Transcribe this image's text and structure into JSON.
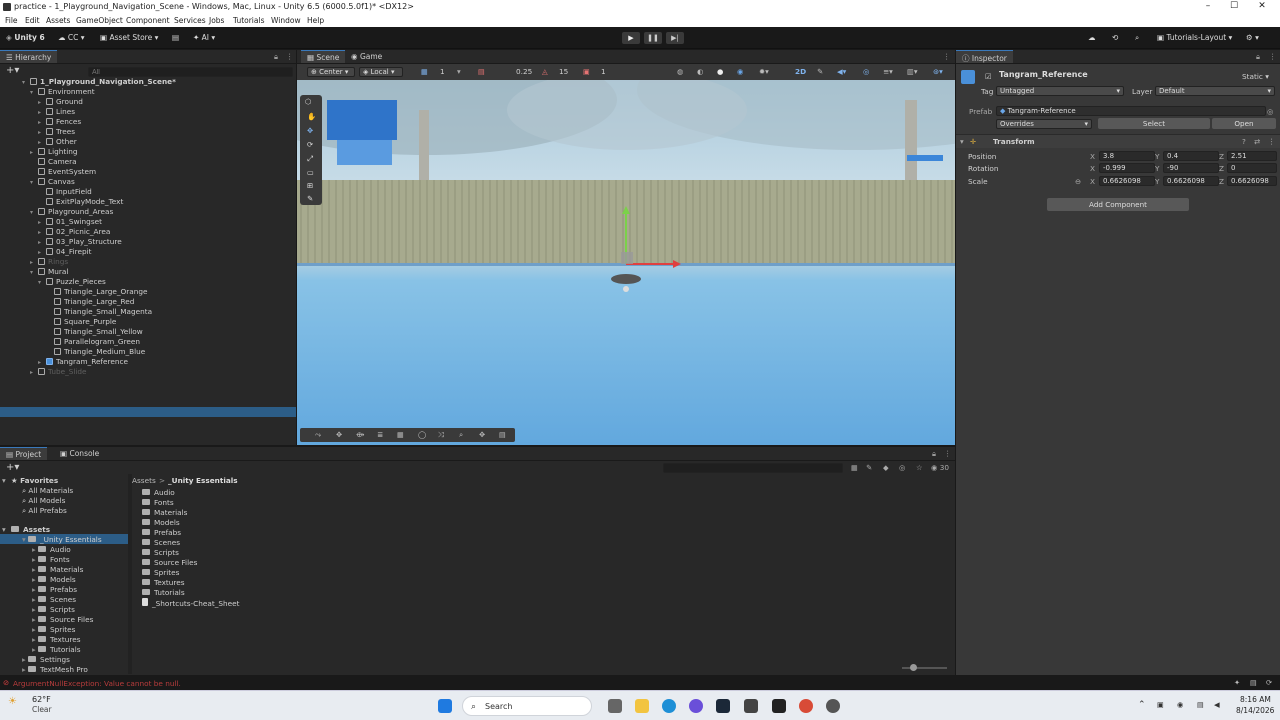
{
  "window": {
    "title": "practice - 1_Playground_Navigation_Scene - Windows, Mac, Linux - Unity 6.5 (6000.5.0f1)* <DX12>"
  },
  "menu": [
    "File",
    "Edit",
    "Assets",
    "GameObject",
    "Component",
    "Services",
    "Jobs",
    "Tutorials",
    "Window",
    "Help"
  ],
  "toolbar": {
    "brand": "Unity 6",
    "account": "CC",
    "asset_store": "Asset Store",
    "ai": "AI",
    "layout": "Tutorials-Layout"
  },
  "hierarchy": {
    "tab": "Hierarchy",
    "search_placeholder": "All",
    "items": [
      {
        "label": "1_Playground_Navigation_Scene*",
        "indent": 0
      },
      {
        "label": "Environment",
        "indent": 1
      },
      {
        "label": "Ground",
        "indent": 2
      },
      {
        "label": "Lines",
        "indent": 2
      },
      {
        "label": "Fences",
        "indent": 2
      },
      {
        "label": "Trees",
        "indent": 2
      },
      {
        "label": "Other",
        "indent": 2
      },
      {
        "label": "Lighting",
        "indent": 1
      },
      {
        "label": "Camera",
        "indent": 1
      },
      {
        "label": "EventSystem",
        "indent": 1
      },
      {
        "label": "Canvas",
        "indent": 1
      },
      {
        "label": "InputField",
        "indent": 2
      },
      {
        "label": "ExitPlayMode_Text",
        "indent": 2
      },
      {
        "label": "Playground_Areas",
        "indent": 1
      },
      {
        "label": "01_Swingset",
        "indent": 2
      },
      {
        "label": "02_Picnic_Area",
        "indent": 2
      },
      {
        "label": "03_Play_Structure",
        "indent": 2
      },
      {
        "label": "04_Firepit",
        "indent": 2
      },
      {
        "label": "Rings",
        "indent": 1,
        "dim": true
      },
      {
        "label": "Mural",
        "indent": 1
      },
      {
        "label": "Puzzle_Pieces",
        "indent": 2
      },
      {
        "label": "Triangle_Large_Orange",
        "indent": 3
      },
      {
        "label": "Triangle_Large_Red",
        "indent": 3
      },
      {
        "label": "Triangle_Small_Magenta",
        "indent": 3
      },
      {
        "label": "Square_Purple",
        "indent": 3
      },
      {
        "label": "Triangle_Small_Yellow",
        "indent": 3
      },
      {
        "label": "Parallelogram_Green",
        "indent": 3
      },
      {
        "label": "Triangle_Medium_Blue",
        "indent": 3
      },
      {
        "label": "Tangram_Reference",
        "indent": 2
      },
      {
        "label": "Tube_Slide",
        "indent": 1,
        "dim": true
      }
    ]
  },
  "scene": {
    "tabs": [
      "Scene",
      "Game"
    ],
    "pivot": "Center",
    "space": "Local",
    "grid_value": "1",
    "snap_value": "0.25",
    "rotate_snap": "15",
    "scale_snap": "1",
    "mode_2d": "2D"
  },
  "inspector": {
    "tab": "Inspector",
    "object_name": "Tangram_Reference",
    "static_label": "Static",
    "tag_label": "Tag",
    "tag_value": "Untagged",
    "layer_label": "Layer",
    "layer_value": "Default",
    "prefab_label": "Prefab",
    "prefab_value": "Tangram-Reference",
    "overrides": "Overrides",
    "select": "Select",
    "open": "Open",
    "transform_title": "Transform",
    "position_label": "Position",
    "rotation_label": "Rotation",
    "scale_label": "Scale",
    "position": {
      "x": "3.8",
      "y": "0.4",
      "z": "2.51"
    },
    "rotation": {
      "x": "-0.999",
      "y": "-90",
      "z": "0"
    },
    "scale": {
      "x": "0.6626098",
      "y": "0.6626098",
      "z": "0.6626098"
    },
    "add_component": "Add Component"
  },
  "project": {
    "tabs": [
      "Project",
      "Console"
    ],
    "favorites_title": "Favorites",
    "favorites": [
      "All Materials",
      "All Models",
      "All Prefabs"
    ],
    "assets_title": "Assets",
    "tree": [
      {
        "label": "_Unity Essentials",
        "indent": 1
      },
      {
        "label": "Audio",
        "indent": 2
      },
      {
        "label": "Fonts",
        "indent": 2
      },
      {
        "label": "Materials",
        "indent": 2
      },
      {
        "label": "Models",
        "indent": 2
      },
      {
        "label": "Prefabs",
        "indent": 2
      },
      {
        "label": "Scenes",
        "indent": 2
      },
      {
        "label": "Scripts",
        "indent": 2
      },
      {
        "label": "Source Files",
        "indent": 2
      },
      {
        "label": "Sprites",
        "indent": 2
      },
      {
        "label": "Textures",
        "indent": 2
      },
      {
        "label": "Tutorials",
        "indent": 2
      },
      {
        "label": "Settings",
        "indent": 1
      },
      {
        "label": "TextMesh Pro",
        "indent": 1
      }
    ],
    "breadcrumb_root": "Assets",
    "breadcrumb_sep": ">",
    "breadcrumb_current": "_Unity Essentials",
    "files": [
      "Audio",
      "Fonts",
      "Materials",
      "Models",
      "Prefabs",
      "Scenes",
      "Scripts",
      "Source Files",
      "Sprites",
      "Textures",
      "Tutorials",
      "_Shortcuts-Cheat_Sheet"
    ],
    "count": "30"
  },
  "status": {
    "error": "ArgumentNullException: Value cannot be null."
  },
  "taskbar": {
    "weather_temp": "62°F",
    "weather_desc": "Clear",
    "search": "Search",
    "time": "8:16 AM",
    "date": "8/14/2026"
  },
  "colors": {
    "accent": "#3a79bb",
    "selection": "#2c5d87",
    "error": "#d94040"
  }
}
